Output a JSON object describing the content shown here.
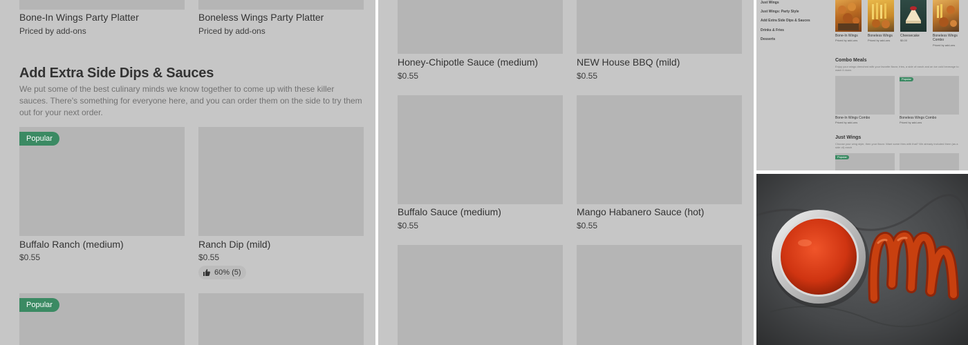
{
  "left": {
    "top_items": [
      {
        "name": "Bone-In Wings Party Platter",
        "sub": "Priced by add-ons"
      },
      {
        "name": "Boneless Wings Party Platter",
        "sub": "Priced by add-ons"
      }
    ],
    "section_title": "Add Extra Side Dips & Sauces",
    "section_desc": "We put some of the best culinary minds we know together to come up with these killer sauces. There's something for everyone here, and you can order them on the side to try them out for your next order.",
    "items": [
      {
        "name": "Buffalo Ranch (medium)",
        "price": "$0.55",
        "badge": "Popular"
      },
      {
        "name": "Ranch Dip (mild)",
        "price": "$0.55",
        "rating": "60% (5)"
      }
    ],
    "bottom_badge": "Popular"
  },
  "middle": {
    "items": [
      {
        "name": "Honey-Chipotle Sauce (medium)",
        "price": "$0.55"
      },
      {
        "name": "NEW House BBQ (mild)",
        "price": "$0.55"
      },
      {
        "name": "Buffalo Sauce (medium)",
        "price": "$0.55"
      },
      {
        "name": "Mango Habanero Sauce (hot)",
        "price": "$0.55"
      }
    ]
  },
  "thumbnail": {
    "sidebar": [
      "Just Wings",
      "Just Wings: Party Style",
      "Add Extra Side Dips & Sauces",
      "Drinks & Fries",
      "Desserts"
    ],
    "top_items": [
      {
        "name": "Bone-In Wings",
        "sub": "Priced by add-ons"
      },
      {
        "name": "Boneless Wings",
        "sub": "Priced by add-ons"
      },
      {
        "name": "Cheesecake",
        "sub": "$5.00"
      },
      {
        "name": "Boneless Wings Combo",
        "sub": "Priced by add-ons"
      }
    ],
    "combo_title": "Combo Meals",
    "combo_desc": "Enjoy your wings drenched with your favorite flavor, fries, a side of ranch and an ice cold beverage to wash it down.",
    "combo_badge": "Popular",
    "combo_items": [
      {
        "name": "Bone-In Wings Combo",
        "sub": "Priced by add-ons"
      },
      {
        "name": "Boneless Wings Combo",
        "sub": "Priced by add-ons"
      }
    ],
    "wings_title": "Just Wings",
    "wings_desc": "Choose your wing style, then your flavor. Want some fries with that? We already included them (as a side of) ranch",
    "wings_badge": "Popular"
  },
  "colors": {
    "overlay": "#c6c6c6",
    "placeholder": "#b5b5b5",
    "badge": "#3b8a63"
  }
}
